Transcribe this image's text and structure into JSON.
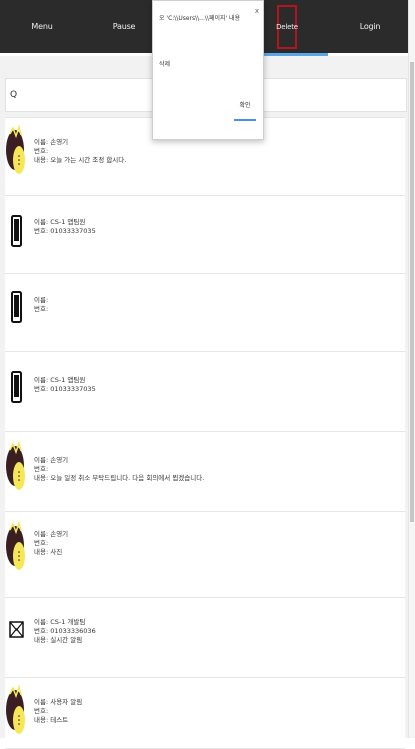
{
  "nav": {
    "menu": "Menu",
    "pause": "Pause",
    "delete": "Delete",
    "login": "Login"
  },
  "search": {
    "glyph": "Q",
    "placeholder": ""
  },
  "dialog": {
    "title": "오 'C:\\\\Users\\\\...\\\\페이지' 내용",
    "close": "x",
    "message": "삭제",
    "ok": "확인"
  },
  "items": [
    {
      "icon": "avatar-cartoon",
      "line1": "이름: 손영기",
      "line2": "번호:",
      "line3": "내용: 오늘 가는 시간 조정 합시다."
    },
    {
      "icon": "phone",
      "line1": "이름: CS-1 앱팀원",
      "line2": "번호: 01033337035",
      "line3": ""
    },
    {
      "icon": "phone",
      "line1": "이름:",
      "line2": "번호:",
      "line3": ""
    },
    {
      "icon": "phone",
      "line1": "이름: CS-1 앱팀원",
      "line2": "번호: 01033337035",
      "line3": ""
    },
    {
      "icon": "avatar-cartoon",
      "line1": "이름: 손영기",
      "line2": "번호:",
      "line3": "내용: 오늘 일정 취소 부탁드립니다. 다음 회의에서 뵙겠습니다."
    },
    {
      "icon": "avatar-cartoon",
      "line1": "이름: 손영기",
      "line2": "번호:",
      "line3": "내용: 사진"
    },
    {
      "icon": "envelope",
      "line1": "이름: CS-1 개발팀",
      "line2": "번호: 01033336036",
      "line3": "내용: 실시간 알림"
    },
    {
      "icon": "avatar-cartoon",
      "line1": "이름: 사용자 알림",
      "line2": "번호:",
      "line3": "내용: 테스트"
    }
  ]
}
